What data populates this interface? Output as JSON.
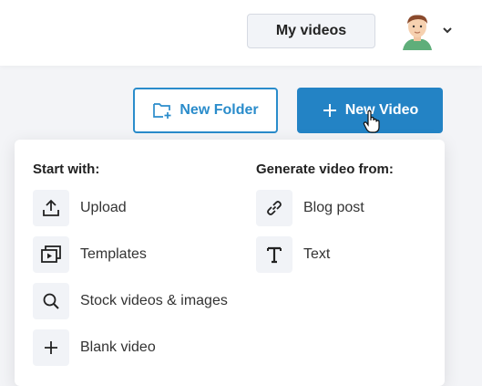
{
  "header": {
    "my_videos_label": "My videos"
  },
  "actions": {
    "new_folder_label": "New Folder",
    "new_video_label": "New Video"
  },
  "menu": {
    "start_heading": "Start with:",
    "generate_heading": "Generate video from:",
    "start_items": [
      {
        "label": "Upload",
        "icon": "upload-icon"
      },
      {
        "label": "Templates",
        "icon": "templates-icon"
      },
      {
        "label": "Stock videos & images",
        "icon": "search-icon"
      },
      {
        "label": "Blank video",
        "icon": "plus-icon"
      }
    ],
    "generate_items": [
      {
        "label": "Blog post",
        "icon": "link-icon"
      },
      {
        "label": "Text",
        "icon": "text-icon"
      }
    ]
  },
  "colors": {
    "accent": "#2383c5",
    "accent_outline": "#2a8ccb",
    "background": "#f3f4f7"
  }
}
